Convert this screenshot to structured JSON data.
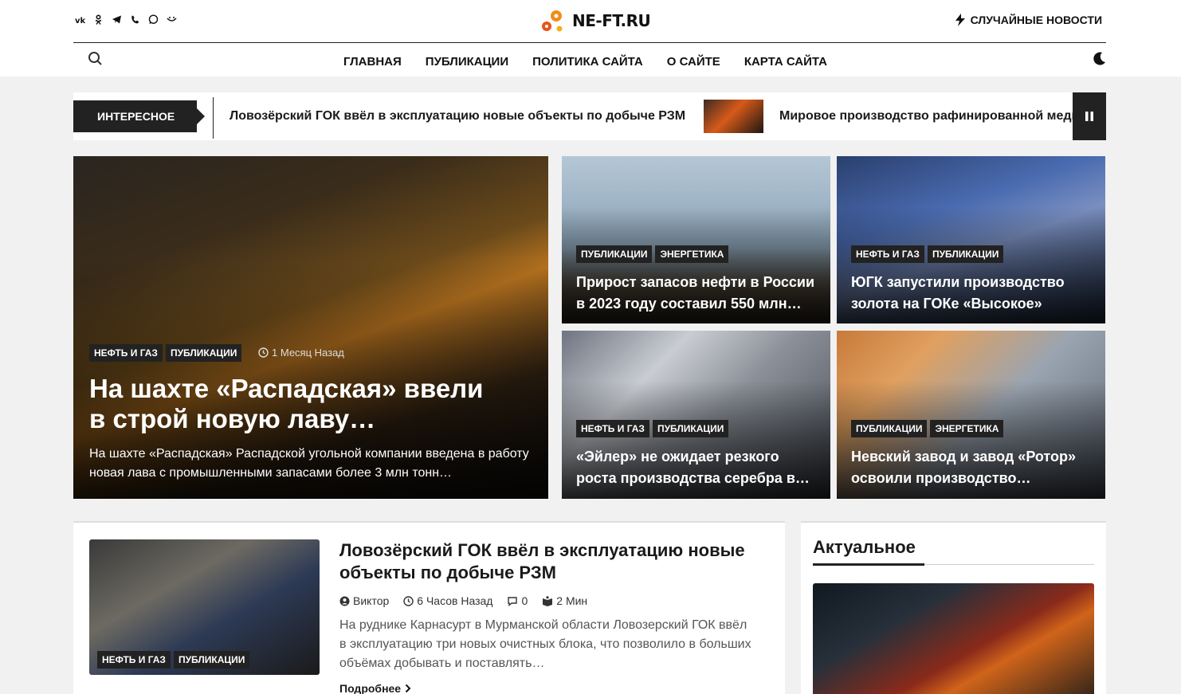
{
  "header": {
    "social_icons": [
      "vk-icon",
      "odnoklassniki-icon",
      "telegram-icon",
      "viber-icon",
      "whatsapp-icon",
      "mail-icon"
    ],
    "logo_text": "NE-FT.RU",
    "random_news_label": "СЛУЧАЙНЫЕ НОВОСТИ"
  },
  "nav": {
    "items": [
      "ГЛАВНАЯ",
      "ПУБЛИКАЦИИ",
      "ПОЛИТИКА САЙТА",
      "О САЙТЕ",
      "КАРТА САЙТА"
    ]
  },
  "ticker": {
    "label": "ИНТЕРЕСНОЕ",
    "item1": "Ловозёрский ГОК ввёл в эксплуатацию новые объекты по добыче РЗМ",
    "item2": "Мировое производство рафинированной меди"
  },
  "hero": {
    "main": {
      "tags": [
        "НЕФТЬ И ГАЗ",
        "ПУБЛИКАЦИИ"
      ],
      "date": "1 Месяц Назад",
      "title": "На шахте «Распадская» ввели в строй новую лаву…",
      "desc": "На шахте «Распадская» Распадской угольной компании введена в работу новая лава с промышленными запасами более 3 млн тонн…"
    },
    "cards": [
      {
        "tags": [
          "ПУБЛИКАЦИИ",
          "ЭНЕРГЕТИКА"
        ],
        "title": "Прирост запасов нефти в России в 2023 году составил 550 млн…"
      },
      {
        "tags": [
          "НЕФТЬ И ГАЗ",
          "ПУБЛИКАЦИИ"
        ],
        "title": "ЮГК запустили производство золота на ГОКе «Высокое»"
      },
      {
        "tags": [
          "НЕФТЬ И ГАЗ",
          "ПУБЛИКАЦИИ"
        ],
        "title": "«Эйлер» не ожидает резкого роста производства серебра в…"
      },
      {
        "tags": [
          "ПУБЛИКАЦИИ",
          "ЭНЕРГЕТИКА"
        ],
        "title": "Невский завод и завод «Ротор» освоили производство…"
      }
    ]
  },
  "article": {
    "tags": [
      "НЕФТЬ И ГАЗ",
      "ПУБЛИКАЦИИ"
    ],
    "title": "Ловозёрский ГОК ввёл в эксплуатацию новые объекты по добыче РЗМ",
    "author": "Виктор",
    "time": "6 Часов Назад",
    "comments": "0",
    "read_time": "2 Мин",
    "excerpt": "На руднике Карнасурт в Мурманской области Ловозерский ГОК ввёл в эксплуатацию три новых очистных блока, что позволило в больших объёмах добывать и поставлять…",
    "more_label": "Подробнее"
  },
  "sidebar": {
    "title": "Актуальное"
  }
}
